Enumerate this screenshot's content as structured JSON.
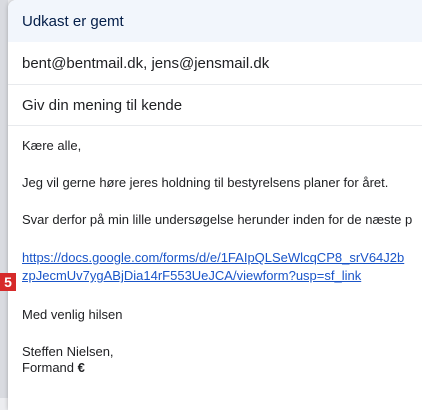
{
  "header": {
    "title": "Udkast er gemt"
  },
  "recipients": {
    "value": "bent@bentmail.dk, jens@jensmail.dk"
  },
  "subject": {
    "value": "Giv din mening til kende"
  },
  "body": {
    "greeting": "Kære alle,",
    "paragraph1": "Jeg vil gerne høre jeres holdning til bestyrelsens planer for året.",
    "paragraph2": "Svar derfor på min lille undersøgelse herunder inden for de næste p",
    "link_line1": "https://docs.google.com/forms/d/e/1FAIpQLSeWlcqCP8_srV64J2b",
    "link_line2": "zpJecmUv7ygABjDia14rF553UeJCA/viewform?usp=sf_link",
    "closing": "Med venlig hilsen",
    "signature_name": "Steffen Nielsen,",
    "signature_title": "Formand",
    "signature_mark": "€"
  },
  "annotation": {
    "badge": "5"
  },
  "colors": {
    "header_bg": "#f2f6fc",
    "link": "#1a55c9",
    "badge": "#d62a2a"
  }
}
